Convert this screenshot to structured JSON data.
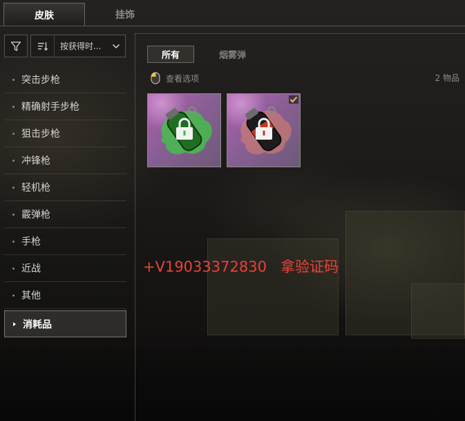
{
  "top_tabs": [
    {
      "label": "皮肤",
      "active": true
    },
    {
      "label": "挂饰",
      "active": false
    }
  ],
  "sort": {
    "label": "按获得时..."
  },
  "categories": [
    {
      "label": "突击步枪",
      "active": false
    },
    {
      "label": "精确射手步枪",
      "active": false
    },
    {
      "label": "狙击步枪",
      "active": false
    },
    {
      "label": "冲锋枪",
      "active": false
    },
    {
      "label": "轻机枪",
      "active": false
    },
    {
      "label": "霰弹枪",
      "active": false
    },
    {
      "label": "手枪",
      "active": false
    },
    {
      "label": "近战",
      "active": false
    },
    {
      "label": "其他",
      "active": false
    },
    {
      "label": "消耗品",
      "active": true
    }
  ],
  "sub_tabs": [
    {
      "label": "所有",
      "active": true
    },
    {
      "label": "烟雾弹",
      "active": false
    }
  ],
  "view_options": {
    "label": "查看选项",
    "icon": "mouse-icon"
  },
  "item_count": "2 物品",
  "items": [
    {
      "name": "green-smoke-grenade",
      "locked": true,
      "equipped": false,
      "accent": "#2fbf3a"
    },
    {
      "name": "red-smoke-grenade",
      "locked": true,
      "equipped": true,
      "accent": "#c23a22"
    }
  ],
  "watermark": "+V19033372830   拿验证码",
  "colors": {
    "accent_check": "#f2c94c",
    "watermark": "#e8433b"
  }
}
